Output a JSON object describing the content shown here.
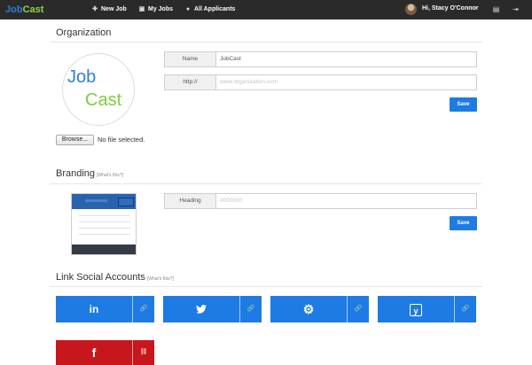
{
  "navbar": {
    "brand_a": "Job",
    "brand_b": "Cast",
    "items": [
      {
        "icon": "plus-icon",
        "label": "New Job"
      },
      {
        "icon": "briefcase-icon",
        "label": "My Jobs"
      },
      {
        "icon": "user-icon",
        "label": "All Applicants"
      }
    ],
    "user_name": "Hi, Stacy O'Connor",
    "right_icons": [
      "clipboard-icon",
      "sign-out-icon"
    ]
  },
  "organization": {
    "title": "Organization",
    "logo_job": "Job",
    "logo_cast": "Cast",
    "browse_label": "Browse...",
    "file_status": "No file selected.",
    "name_label": "Name",
    "name_value": "JobCast",
    "url_label": "http://",
    "url_placeholder": "www.organization.com",
    "save_label": "Save"
  },
  "branding": {
    "title": "Branding",
    "hint": "[What's this?]",
    "heading_label": "Heading",
    "heading_placeholder": "#000000",
    "save_label": "Save"
  },
  "social": {
    "title": "Link Social Accounts",
    "hint": "[What's this?]",
    "accounts": [
      {
        "network": "LinkedIn",
        "glyph": "in",
        "icon": "linkedin-icon",
        "link_icon": "link-icon",
        "color": "#1e7be3",
        "linked": false
      },
      {
        "network": "Twitter",
        "glyph": "🐦",
        "icon": "twitter-icon",
        "link_icon": "link-icon",
        "color": "#1e7be3",
        "linked": false
      },
      {
        "network": "Settings",
        "glyph": "⚙",
        "icon": "gear-icon",
        "link_icon": "link-icon",
        "color": "#1e7be3",
        "linked": false
      },
      {
        "network": "Yammer",
        "glyph": "y",
        "icon": "yammer-icon",
        "link_icon": "link-icon",
        "color": "#1e7be3",
        "linked": false
      },
      {
        "network": "Facebook",
        "glyph": "f",
        "icon": "facebook-icon",
        "link_icon": "unlink-icon",
        "color": "#c8161d",
        "linked": true
      }
    ]
  },
  "colors": {
    "navbar_bg": "#2a2a2a",
    "primary": "#1e7be3",
    "brand_blue": "#2f7fd6",
    "brand_green": "#8fd14f",
    "facebook_red": "#c8161d"
  }
}
